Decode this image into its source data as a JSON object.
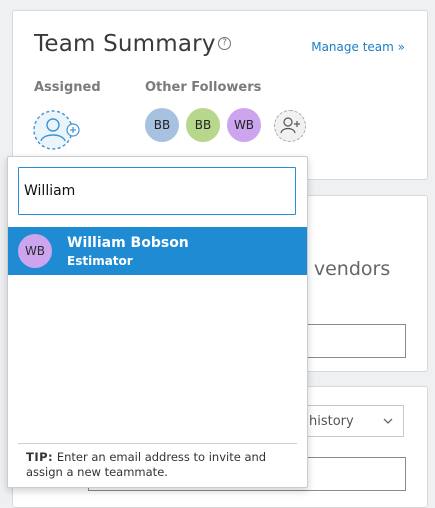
{
  "team_summary": {
    "title": "Team Summary",
    "help_icon": "?",
    "manage_link": "Manage team »",
    "assigned_label": "Assigned",
    "followers_label": "Other Followers",
    "followers": [
      {
        "initials": "BB",
        "color": "#a7c1e0"
      },
      {
        "initials": "BB",
        "color": "#b6d78c"
      },
      {
        "initials": "WB",
        "color": "#cda5ee"
      }
    ]
  },
  "background": {
    "vendors_text": "r vendors",
    "history_select": "history"
  },
  "dropdown": {
    "search_value": "William",
    "results": [
      {
        "initials": "WB",
        "name": "William Bobson",
        "role": "Estimator",
        "color": "#cda5ee"
      }
    ],
    "tip_label": "TIP:",
    "tip_text": "Enter an email address to invite and assign a new teammate."
  }
}
